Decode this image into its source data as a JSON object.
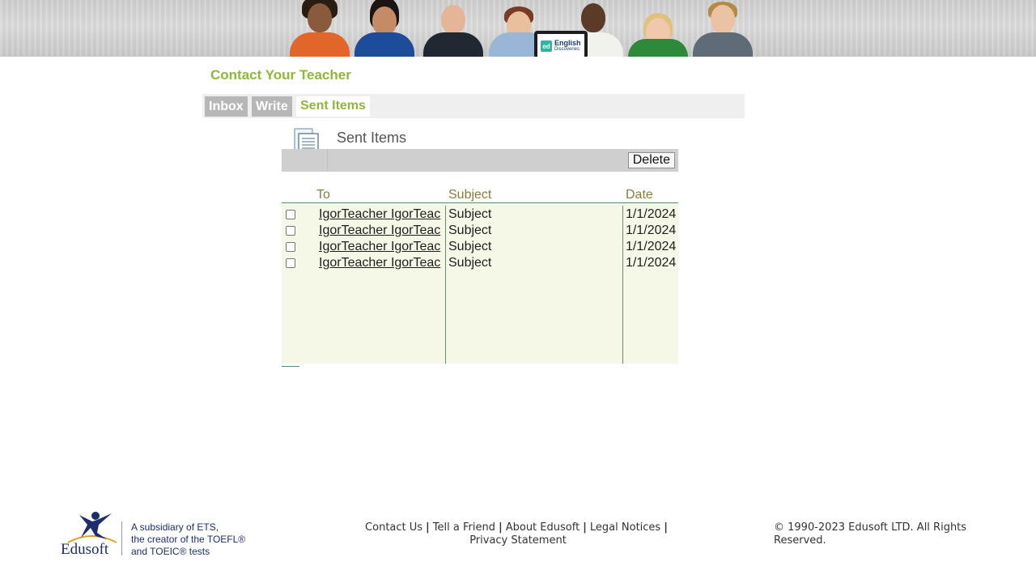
{
  "header": {
    "banner_brand_line1": "English",
    "banner_brand_line2": "Discoveries",
    "banner_logo": "ed"
  },
  "page": {
    "title": "Contact Your Teacher"
  },
  "tabs": [
    {
      "label": "Inbox",
      "active": false
    },
    {
      "label": "Write",
      "active": false
    },
    {
      "label": "Sent Items",
      "active": true
    }
  ],
  "section": {
    "icon": "document-list-icon",
    "title": "Sent Items",
    "delete_label": "Delete"
  },
  "table": {
    "columns": [
      "To",
      "Subject",
      "Date"
    ],
    "rows": [
      {
        "to": "IgorTeacher IgorTeac",
        "subject": "Subject",
        "date": "1/1/2024",
        "checked": false
      },
      {
        "to": "IgorTeacher IgorTeac",
        "subject": "Subject",
        "date": "1/1/2024",
        "checked": false
      },
      {
        "to": "IgorTeacher IgorTeac",
        "subject": "Subject",
        "date": "1/1/2024",
        "checked": false
      },
      {
        "to": "IgorTeacher IgorTeac",
        "subject": "Subject",
        "date": "1/1/2024",
        "checked": false
      }
    ]
  },
  "footer": {
    "logo_text": "Edusoft",
    "tagline_line1": "A subsidiary of ETS,",
    "tagline_line2": "the creator of the TOEFL®",
    "tagline_line3": "and TOEIC® tests",
    "links": [
      "Contact Us",
      "Tell a Friend",
      "About Edusoft",
      "Legal Notices",
      "Privacy Statement"
    ],
    "copyright": "© 1990-2023 Edusoft LTD. All Rights Reserved."
  },
  "colors": {
    "accent_green": "#8fb83a",
    "table_bg": "#f5f8e6",
    "header_text": "#8a7a3a",
    "brand_navy": "#1c2e6e"
  }
}
